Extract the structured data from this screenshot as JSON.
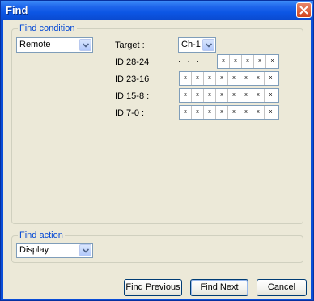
{
  "window": {
    "title": "Find"
  },
  "find_condition": {
    "legend": "Find condition",
    "source_select": {
      "value": "Remote"
    },
    "target": {
      "label": "Target :",
      "value": "Ch-1"
    },
    "id_rows": [
      {
        "label": "ID 28-24",
        "prefix_dots": "· · ·",
        "cells": [
          "x",
          "x",
          "x",
          "x",
          "x"
        ]
      },
      {
        "label": "ID 23-16",
        "cells": [
          "x",
          "x",
          "x",
          "x",
          "x",
          "x",
          "x",
          "x"
        ]
      },
      {
        "label": "ID 15-8 :",
        "cells": [
          "x",
          "x",
          "x",
          "x",
          "x",
          "x",
          "x",
          "x"
        ]
      },
      {
        "label": "ID 7-0 :",
        "cells": [
          "x",
          "x",
          "x",
          "x",
          "x",
          "x",
          "x",
          "x"
        ]
      }
    ]
  },
  "find_action": {
    "legend": "Find action",
    "select": {
      "value": "Display"
    }
  },
  "buttons": {
    "find_previous": "Find Previous",
    "find_next": "Find Next",
    "cancel": "Cancel"
  }
}
